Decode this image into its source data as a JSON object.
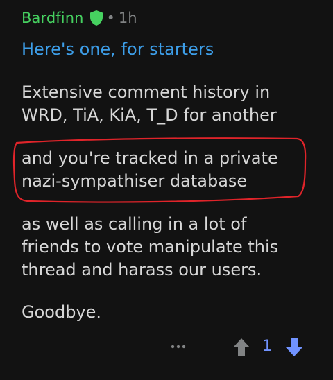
{
  "comment": {
    "author": "Bardfinn",
    "separator": "•",
    "age": "1h",
    "link_text": "Here's one, for starters",
    "paragraph_1": {
      "line_1": "Extensive comment history in",
      "line_2": "WRD, TiA, KiA, T_D for another"
    },
    "paragraph_2": {
      "line_1": "and you're tracked in a private",
      "line_2": "nazi-sympathiser database"
    },
    "paragraph_3": {
      "line_1": "as well as calling in a lot of",
      "line_2": "friends to vote manipulate this",
      "line_3": "thread and harass our users."
    },
    "paragraph_4": "Goodbye.",
    "score": "1"
  },
  "icons": {
    "moderator": "shield-icon",
    "more": "more-options-icon",
    "upvote": "upvote-arrow-icon",
    "downvote": "downvote-arrow-icon"
  },
  "colors": {
    "background": "#121212",
    "username": "#46d160",
    "link": "#3d9ee8",
    "body_text": "#d7d7d7",
    "muted": "#818384",
    "upvote_active": "#7193ff",
    "annotation": "#e0242a"
  }
}
